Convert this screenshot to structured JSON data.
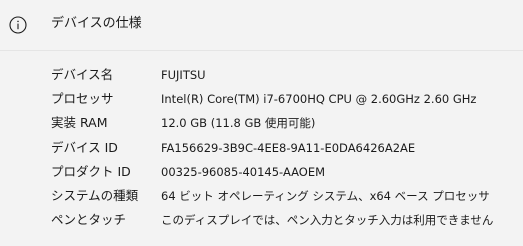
{
  "header": {
    "title": "デバイスの仕様",
    "icon": "info-icon"
  },
  "specs": [
    {
      "label": "デバイス名",
      "value": "FUJITSU"
    },
    {
      "label": "プロセッサ",
      "value": "Intel(R) Core(TM) i7-6700HQ CPU @ 2.60GHz   2.60 GHz"
    },
    {
      "label": "実装 RAM",
      "value": "12.0 GB (11.8 GB 使用可能)"
    },
    {
      "label": "デバイス ID",
      "value": "FA156629-3B9C-4EE8-9A11-E0DA6426A2AE"
    },
    {
      "label": "プロダクト ID",
      "value": "00325-96085-40145-AAOEM"
    },
    {
      "label": "システムの種類",
      "value": "64 ビット オペレーティング システム、x64 ベース プロセッサ"
    },
    {
      "label": "ペンとタッチ",
      "value": "このディスプレイでは、ペン入力とタッチ入力は利用できません"
    }
  ]
}
